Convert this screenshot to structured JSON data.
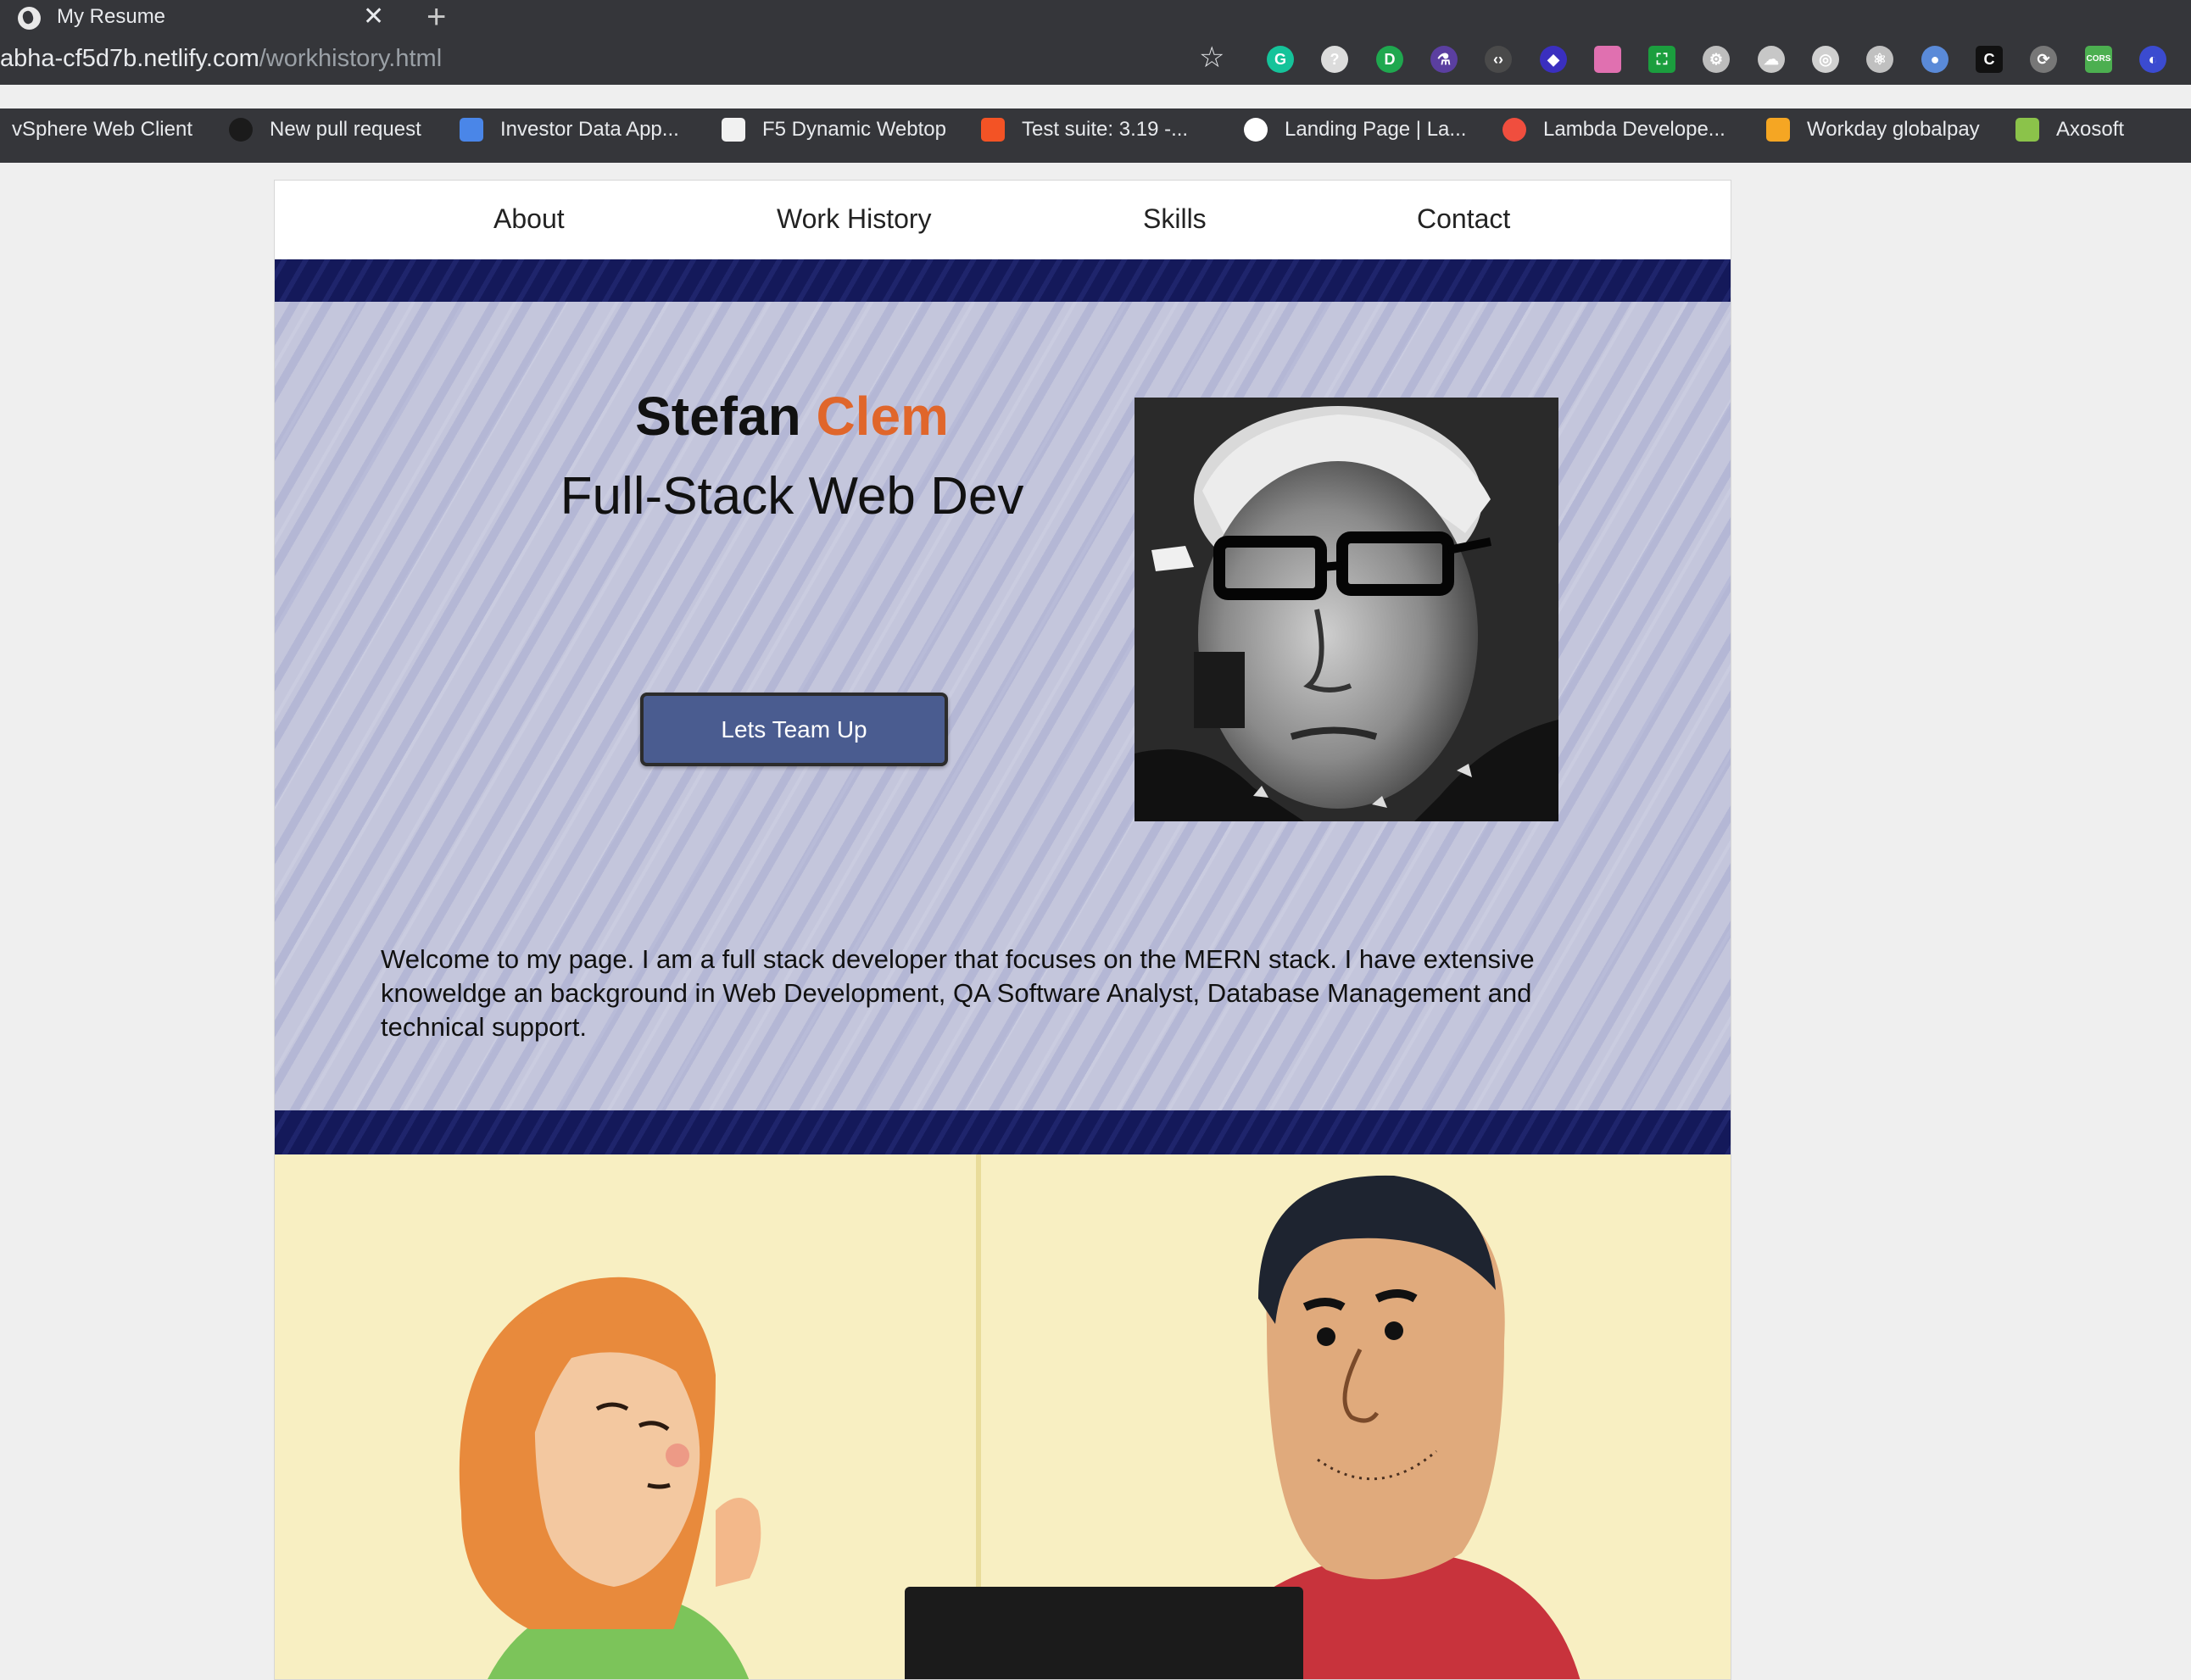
{
  "browser": {
    "tab_title": "My Resume",
    "tab_close": "✕",
    "new_tab": "+",
    "url_host": "abha-cf5d7b.netlify.com",
    "url_path": "/workhistory.html",
    "bookmark_star": "☆",
    "bookmarks": [
      {
        "label": "vSphere Web Client",
        "icon": "none",
        "color": "#35363a"
      },
      {
        "label": "New pull request",
        "icon": "github-icon",
        "color": "#1b1b1b"
      },
      {
        "label": "Investor Data App...",
        "icon": "google-docs-icon",
        "color": "#4a86e8"
      },
      {
        "label": "F5 Dynamic Webtop",
        "icon": "document-icon",
        "color": "#f1f1f1"
      },
      {
        "label": "Test suite: 3.19 -...",
        "icon": "microsoft-icon",
        "color": "#f35325"
      },
      {
        "label": "Landing Page | La...",
        "icon": "smiley-icon",
        "color": "#ffffff"
      },
      {
        "label": "Lambda Develope...",
        "icon": "lambda-icon",
        "color": "#f04e3e"
      },
      {
        "label": "Workday globalpay",
        "icon": "workday-icon",
        "color": "#f5a623"
      },
      {
        "label": "Axosoft",
        "icon": "axosoft-icon",
        "color": "#8bc34a"
      }
    ],
    "extensions": [
      {
        "name": "grammarly-icon",
        "color": "#15c39a",
        "glyph": "G"
      },
      {
        "name": "help-icon",
        "color": "#dcdcdc",
        "glyph": "?"
      },
      {
        "name": "id-icon",
        "color": "#1fa84f",
        "glyph": "D"
      },
      {
        "name": "flask-icon",
        "color": "#5b3fa0",
        "glyph": "⚗"
      },
      {
        "name": "code-icon",
        "color": "#4a4a4a",
        "glyph": "‹›"
      },
      {
        "name": "layers-icon",
        "color": "#3a2fbf",
        "glyph": "◆"
      },
      {
        "name": "gradient-icon",
        "color": "#e070b0",
        "glyph": ""
      },
      {
        "name": "screenshot-icon",
        "color": "#1b9e3e",
        "glyph": "⛶"
      },
      {
        "name": "gear-icon",
        "color": "#bdbdbd",
        "glyph": "⚙"
      },
      {
        "name": "cloud-icon",
        "color": "#c7c7c7",
        "glyph": "☁"
      },
      {
        "name": "target-icon",
        "color": "#d0d0d0",
        "glyph": "◎"
      },
      {
        "name": "react-icon",
        "color": "#c0c0c0",
        "glyph": "⚛"
      },
      {
        "name": "vpn-icon",
        "color": "#5a8ad8",
        "glyph": "●"
      },
      {
        "name": "c-icon",
        "color": "#111111",
        "glyph": "C"
      },
      {
        "name": "sync-icon",
        "color": "#777777",
        "glyph": "⟳"
      },
      {
        "name": "cors-icon",
        "color": "#4caf50",
        "glyph": "CORS"
      },
      {
        "name": "globe-icon",
        "color": "#3b4bd0",
        "glyph": "◐"
      }
    ]
  },
  "nav": {
    "items": [
      {
        "label": "About"
      },
      {
        "label": "Work History"
      },
      {
        "label": "Skills"
      },
      {
        "label": "Contact"
      }
    ]
  },
  "hero": {
    "first_name": "Stefan",
    "last_name": "Clem",
    "title": "Full-Stack Web Dev",
    "cta_label": "Lets Team Up",
    "bio": "Welcome to my page. I am a full stack developer that focuses on the MERN stack. I have extensive knoweldge an background in Web Development, QA Software Analyst, Database Management and technical support.",
    "accent_color": "#e0662b",
    "button_color": "#4a5c90"
  }
}
